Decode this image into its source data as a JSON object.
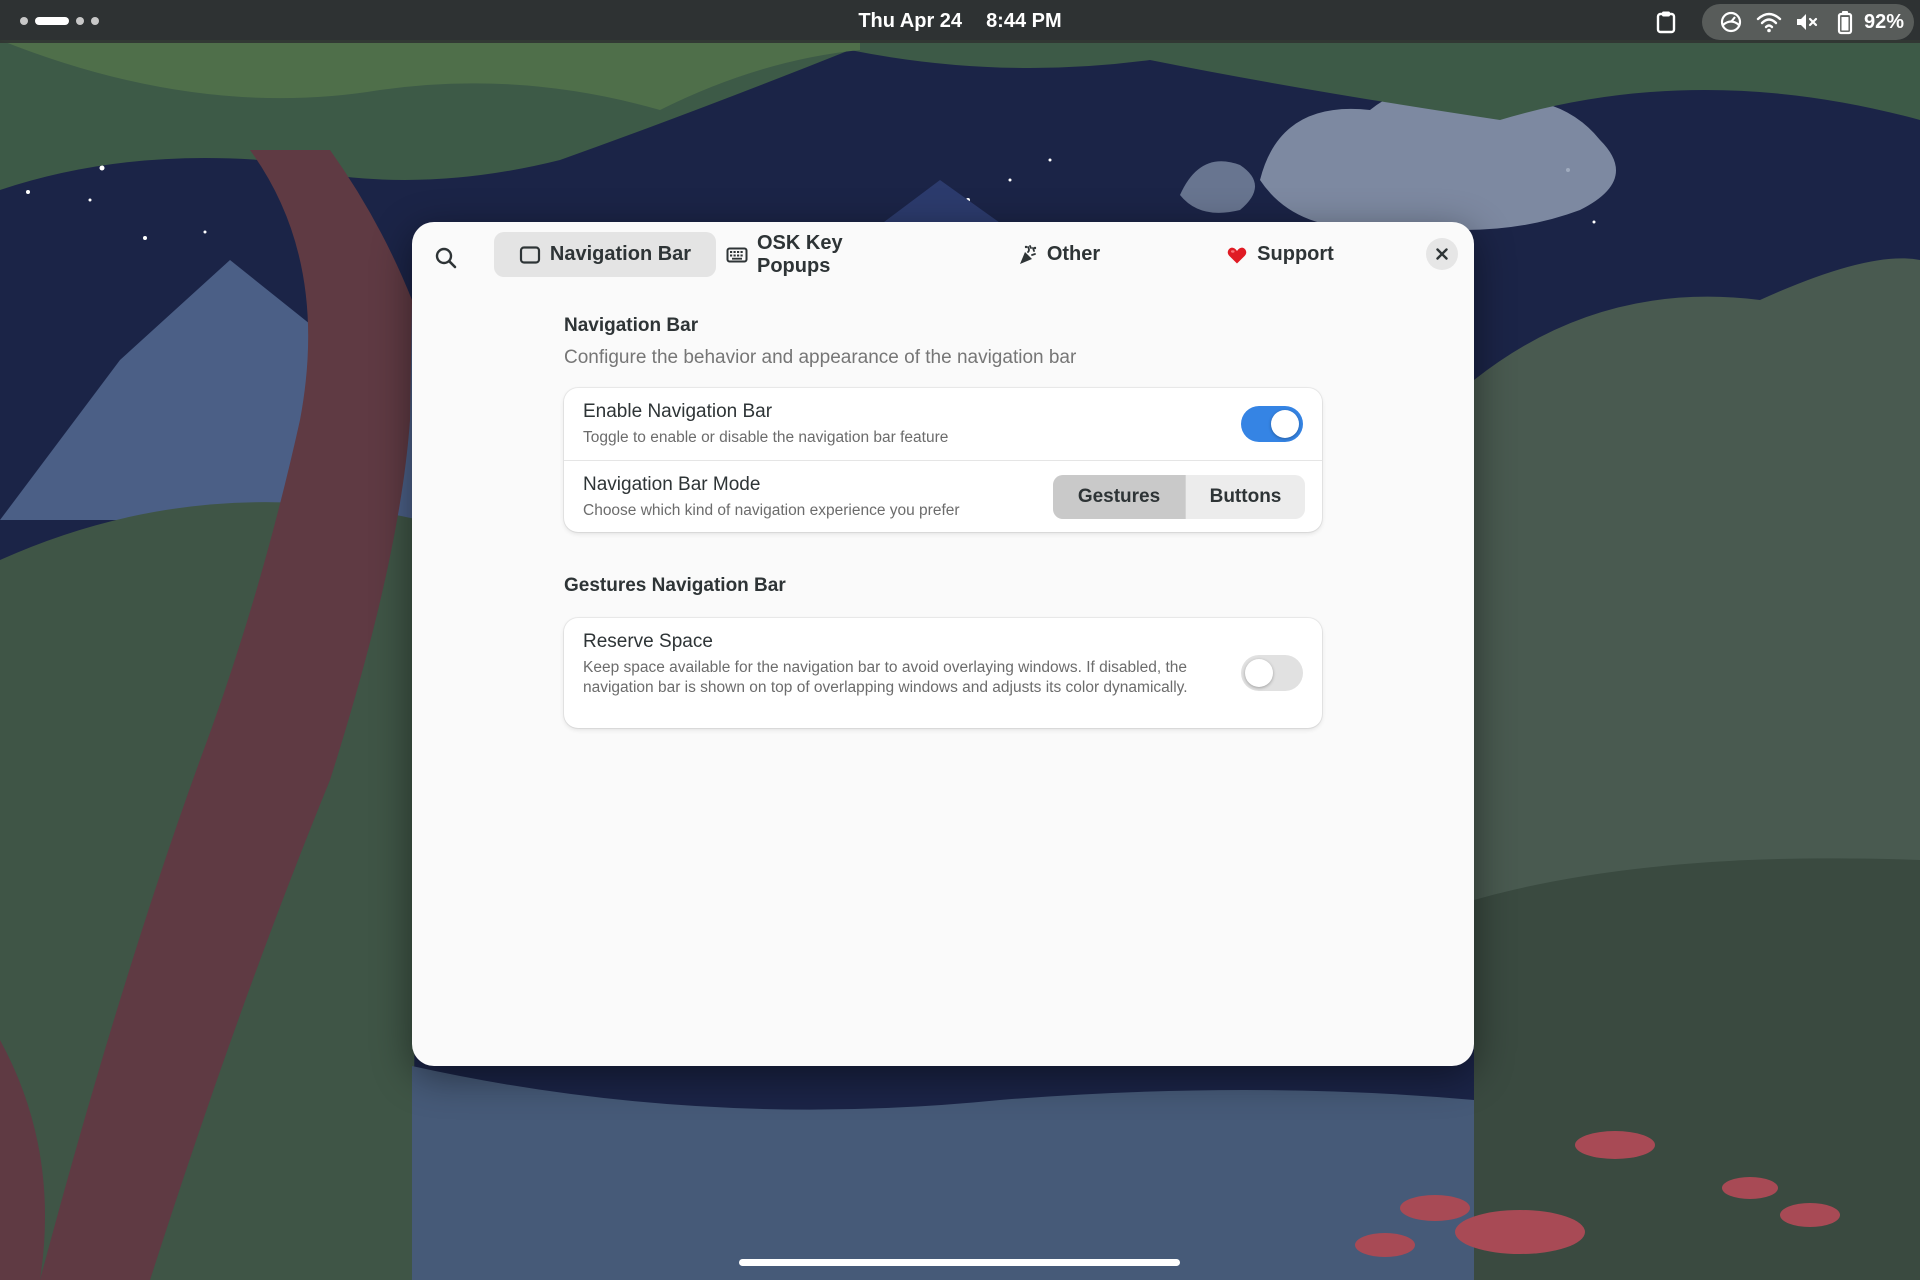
{
  "topbar": {
    "date": "Thu Apr 24",
    "time": "8:44 PM",
    "battery_percent": "92%",
    "workspace_count": 4,
    "active_workspace_index": 1,
    "icons": [
      "clipboard-icon",
      "power-profile-icon",
      "wifi-icon",
      "volume-muted-icon",
      "battery-icon"
    ]
  },
  "dialog": {
    "tabs": [
      {
        "label": "Navigation Bar",
        "icon": "screen-icon",
        "active": true
      },
      {
        "label": "OSK Key Popups",
        "icon": "keyboard-icon",
        "active": false
      },
      {
        "label": "Other",
        "icon": "party-icon",
        "active": false
      },
      {
        "label": "Support",
        "icon": "heart-icon",
        "active": false
      }
    ],
    "sections": {
      "navbar": {
        "title": "Navigation Bar",
        "description": "Configure the behavior and appearance of the navigation bar",
        "rows": {
          "enable": {
            "title": "Enable Navigation Bar",
            "subtitle": "Toggle to enable or disable the navigation bar feature",
            "enabled": true
          },
          "mode": {
            "title": "Navigation Bar Mode",
            "subtitle": "Choose which kind of navigation experience you prefer",
            "options": [
              "Gestures",
              "Buttons"
            ],
            "selected": "Gestures"
          }
        }
      },
      "gestures": {
        "title": "Gestures Navigation Bar",
        "rows": {
          "reserve": {
            "title": "Reserve Space",
            "subtitle": "Keep space available for the navigation bar to avoid overlaying windows. If disabled, the navigation bar is shown on top of overlapping windows and adjusts its color dynamically.",
            "enabled": false
          }
        }
      }
    }
  },
  "colors": {
    "accent": "#3584e4",
    "dialog_bg": "#fafafa",
    "topbar_bg": "#303432"
  }
}
